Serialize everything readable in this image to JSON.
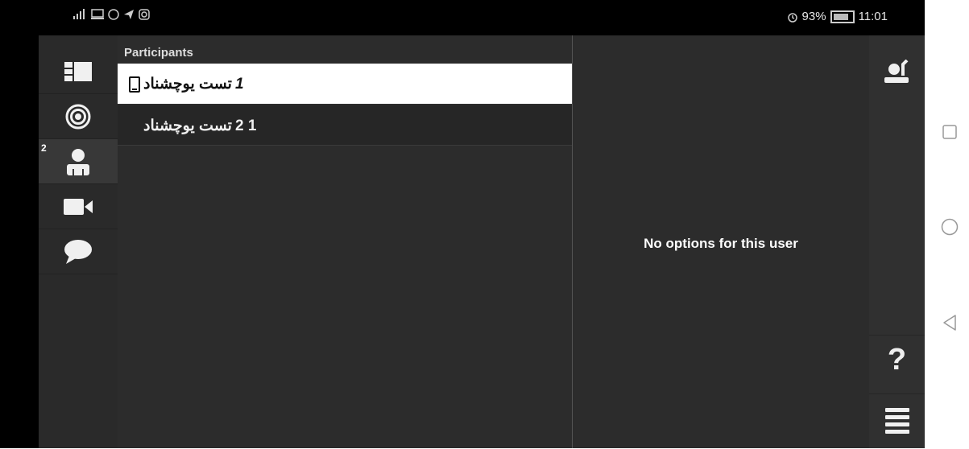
{
  "status_bar": {
    "left_icons": [
      "signal-icon",
      "cast-icon",
      "whatsapp-icon",
      "telegram-icon",
      "instagram-icon"
    ],
    "battery": "93%",
    "time": "11:01"
  },
  "sidebar": {
    "items": [
      {
        "name": "layout",
        "icon": "layout-icon"
      },
      {
        "name": "broadcast",
        "icon": "target-icon"
      },
      {
        "name": "participants",
        "icon": "person-icon",
        "badge": "2",
        "active": true
      },
      {
        "name": "camera",
        "icon": "camera-icon"
      },
      {
        "name": "chat",
        "icon": "chat-icon"
      }
    ]
  },
  "participants": {
    "title": "Participants",
    "rows": [
      {
        "number": "1",
        "name": "تست یوچشناد",
        "device": "phone",
        "selected": true
      },
      {
        "number": "2 1",
        "name": "تست یوچشناد",
        "selected": false
      }
    ]
  },
  "options": {
    "message": "No options for this user"
  },
  "right_bar": {
    "help_label": "?"
  },
  "colors": {
    "background": "#2c2c2c",
    "selected_row": "#ffffff",
    "text": "#ffffff"
  }
}
